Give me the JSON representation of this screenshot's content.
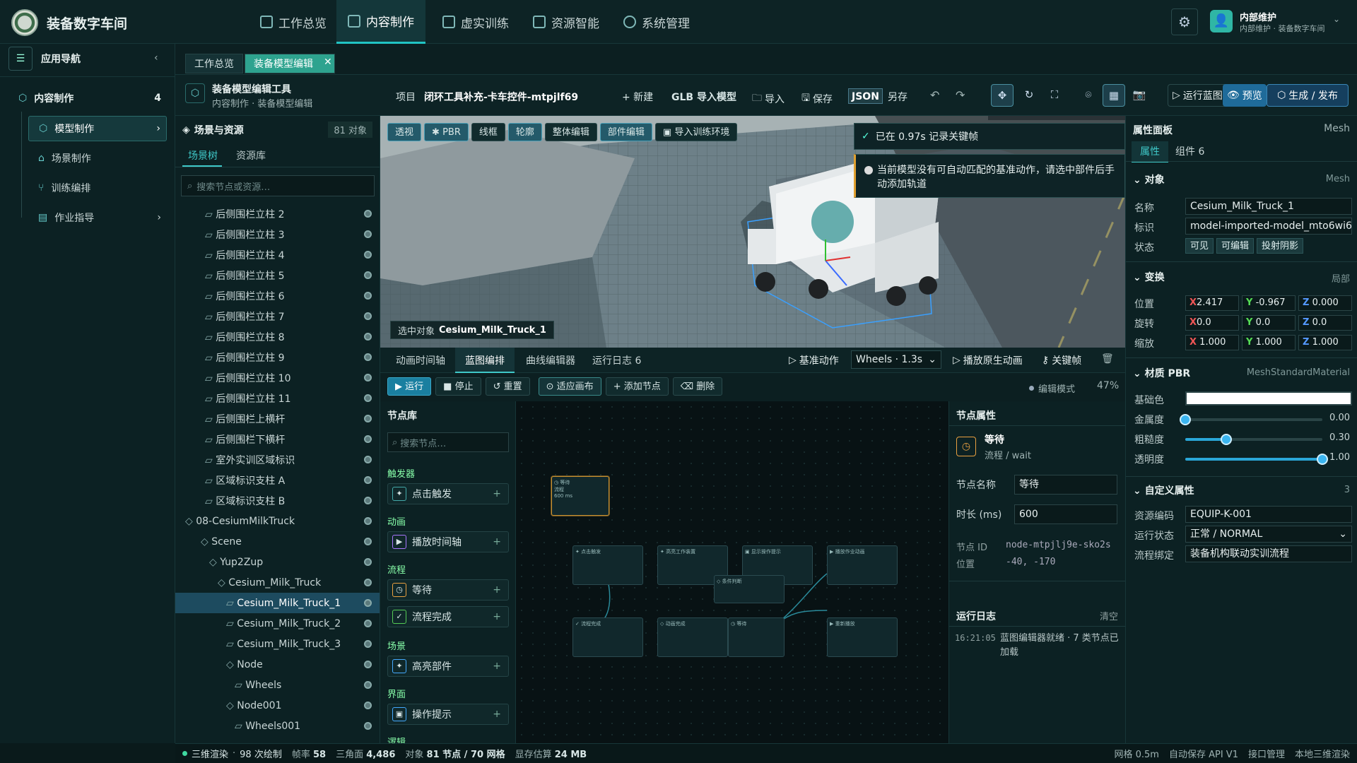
{
  "app": {
    "title": "装备数字车间"
  },
  "nav": [
    {
      "label": "工作总览",
      "icon": "grid-icon"
    },
    {
      "label": "内容制作",
      "icon": "cube-icon"
    },
    {
      "label": "虚实训练",
      "icon": "book-icon"
    },
    {
      "label": "资源智能",
      "icon": "brain-icon"
    },
    {
      "label": "系统管理",
      "icon": "gear-icon"
    }
  ],
  "user": {
    "name": "内部维护",
    "sub": "内部维护 · 装备数字车间"
  },
  "sidebar": {
    "title": "应用导航",
    "section": {
      "label": "内容制作",
      "count": "4"
    },
    "items": [
      {
        "label": "模型制作"
      },
      {
        "label": "场景制作"
      },
      {
        "label": "训练编排"
      },
      {
        "label": "作业指导"
      }
    ]
  },
  "tabs": [
    {
      "label": "工作总览"
    },
    {
      "label": "装备模型编辑"
    }
  ],
  "toolbar": {
    "title": "装备模型编辑工具",
    "subtitle": "内容制作 · 装备模型编辑",
    "project_label": "项目",
    "project_name": "闭环工具补充-卡车控件-mtpjlf69",
    "new": "+ 新建",
    "import_model": "GLB 导入模型",
    "import": "导入",
    "save": "保存",
    "json": "JSON",
    "save_as": "另存",
    "run_blueprint": "运行蓝图",
    "preview": "预览",
    "publish": "生成 / 发布"
  },
  "scene": {
    "title": "场景与资源",
    "count": "81 对象",
    "tabs": [
      "场景树",
      "资源库"
    ],
    "search_placeholder": "搜索节点或资源…",
    "rows": [
      {
        "label": "后侧围栏立柱 2",
        "indent": 0
      },
      {
        "label": "后侧围栏立柱 3",
        "indent": 0
      },
      {
        "label": "后侧围栏立柱 4",
        "indent": 0
      },
      {
        "label": "后侧围栏立柱 5",
        "indent": 0
      },
      {
        "label": "后侧围栏立柱 6",
        "indent": 0
      },
      {
        "label": "后侧围栏立柱 7",
        "indent": 0
      },
      {
        "label": "后侧围栏立柱 8",
        "indent": 0
      },
      {
        "label": "后侧围栏立柱 9",
        "indent": 0
      },
      {
        "label": "后侧围栏立柱 10",
        "indent": 0
      },
      {
        "label": "后侧围栏立柱 11",
        "indent": 0
      },
      {
        "label": "后侧围栏上横杆",
        "indent": 0
      },
      {
        "label": "后侧围栏下横杆",
        "indent": 0
      },
      {
        "label": "室外实训区域标识",
        "indent": 0
      },
      {
        "label": "区域标识支柱 A",
        "indent": 0
      },
      {
        "label": "区域标识支柱 B",
        "indent": 0
      },
      {
        "label": "08-CesiumMilkTruck",
        "indent": -1
      },
      {
        "label": "Scene",
        "indent": 0
      },
      {
        "label": "Yup2Zup",
        "indent": 1
      },
      {
        "label": "Cesium_Milk_Truck",
        "indent": 2
      },
      {
        "label": "Cesium_Milk_Truck_1",
        "indent": 3
      },
      {
        "label": "Cesium_Milk_Truck_2",
        "indent": 3
      },
      {
        "label": "Cesium_Milk_Truck_3",
        "indent": 3
      },
      {
        "label": "Node",
        "indent": 3
      },
      {
        "label": "Wheels",
        "indent": 4
      },
      {
        "label": "Node001",
        "indent": 3
      },
      {
        "label": "Wheels001",
        "indent": 4
      }
    ]
  },
  "viewport": {
    "modes": [
      "透视",
      "PBR",
      "线框",
      "轮廓",
      "整体编辑",
      "部件编辑",
      "导入训练环境"
    ],
    "toast1": "已在 0.97s 记录关键帧",
    "toast2": "当前模型没有可自动匹配的基准动作，请选中部件后手动添加轨道",
    "selected_label": "选中对象",
    "selected_name": "Cesium_Milk_Truck_1"
  },
  "editor": {
    "tabs": [
      "动画时间轴",
      "蓝图编排",
      "曲线编辑器",
      "运行日志 6"
    ],
    "base_action": "基准动作",
    "track": "Wheels · 1.3s",
    "play_anim": "播放原生动画",
    "keyframe": "关键帧",
    "run": "运行",
    "stop": "停止",
    "reset": "重置",
    "fit": "适应画布",
    "add_node": "添加节点",
    "delete": "删除",
    "mode": "编辑模式",
    "zoom": "47%"
  },
  "nodeLib": {
    "title": "节点库",
    "search_placeholder": "搜索节点…",
    "cats": [
      "触发器",
      "动画",
      "流程",
      "场景",
      "界面",
      "逻辑"
    ],
    "items": [
      "点击触发",
      "播放时间轴",
      "等待",
      "流程完成",
      "高亮部件",
      "操作提示"
    ]
  },
  "nodeProps": {
    "title": "节点属性",
    "node_name": "等待",
    "node_type": "流程 / wait",
    "name_label": "节点名称",
    "name_value": "等待",
    "dur_label": "时长 (ms)",
    "dur_value": "600",
    "id_label": "节点 ID",
    "id_value": "node-mtpjlj9e-sko2s",
    "pos_label": "位置",
    "pos_value": "-40, -170",
    "log_title": "运行日志",
    "log_clear": "清空",
    "log_time": "16:21:05",
    "log_msg": "蓝图编辑器就绪 · 7 类节点已加载"
  },
  "props": {
    "title": "属性面板",
    "type": "Mesh",
    "tabs": [
      "属性",
      "组件 6"
    ],
    "object": {
      "title": "对象",
      "type": "Mesh",
      "name_label": "名称",
      "name": "Cesium_Milk_Truck_1",
      "id_label": "标识",
      "id": "model-imported-model_mto6wi6",
      "state_label": "状态",
      "states": [
        "可见",
        "可编辑",
        "投射阴影"
      ]
    },
    "transform": {
      "title": "变换",
      "space": "局部",
      "pos_label": "位置",
      "pos": [
        "2.417",
        "-0.967",
        "0.000"
      ],
      "rot_label": "旋转",
      "rot": [
        "0.0",
        "0.0",
        "0.0"
      ],
      "scale_label": "缩放",
      "scale": [
        "1.000",
        "1.000",
        "1.000"
      ]
    },
    "material": {
      "title": "材质 PBR",
      "type": "MeshStandardMaterial",
      "base_label": "基础色",
      "metal_label": "金属度",
      "metal": 0.0,
      "metal_txt": "0.00",
      "rough_label": "粗糙度",
      "rough": 0.3,
      "rough_txt": "0.30",
      "opacity_label": "透明度",
      "opacity": 1.0,
      "opacity_txt": "1.00"
    },
    "custom": {
      "title": "自定义属性",
      "count": "3",
      "code_label": "资源编码",
      "code": "EQUIP-K-001",
      "run_label": "运行状态",
      "run": "正常 / NORMAL",
      "flow_label": "流程绑定",
      "flow": "装备机构联动实训流程"
    }
  },
  "status": {
    "render": "三维渲染",
    "draws": "98 次绘制",
    "fps_label": "帧率",
    "fps": "58",
    "tri_label": "三角面",
    "tri": "4,486",
    "obj_label": "对象",
    "obj": "81 节点 / 70 网格",
    "mem_label": "显存估算",
    "mem": "24 MB",
    "grid": "网格 0.5m",
    "autosave": "自动保存 API V1",
    "api": "接口管理",
    "local": "本地三维渲染"
  }
}
